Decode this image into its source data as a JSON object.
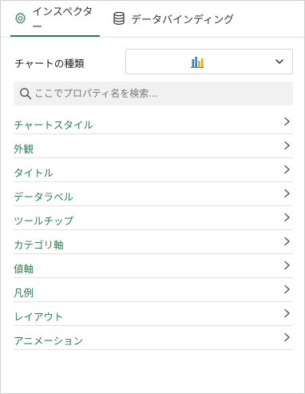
{
  "tabs": {
    "inspector": {
      "label": "インスペクター",
      "icon": "gear-icon",
      "active": true
    },
    "data_binding": {
      "label": "データバインディング",
      "icon": "database-icon",
      "active": false
    }
  },
  "chart_type": {
    "label": "チャートの種類",
    "selected_icon": "bar-chart-icon"
  },
  "search": {
    "placeholder": "ここでプロパティ名を検索..."
  },
  "properties": [
    {
      "label": "チャートスタイル"
    },
    {
      "label": "外観"
    },
    {
      "label": "タイトル"
    },
    {
      "label": "データラベル"
    },
    {
      "label": "ツールチップ"
    },
    {
      "label": "カテゴリ軸"
    },
    {
      "label": "値軸"
    },
    {
      "label": "凡例"
    },
    {
      "label": "レイアウト"
    },
    {
      "label": "アニメーション"
    }
  ],
  "colors": {
    "accent": "#2e7d58",
    "divider": "#e1e1e1",
    "search_bg": "#f1f1f1",
    "chart_bars": [
      "#3b7fc4",
      "#e8a530"
    ]
  }
}
